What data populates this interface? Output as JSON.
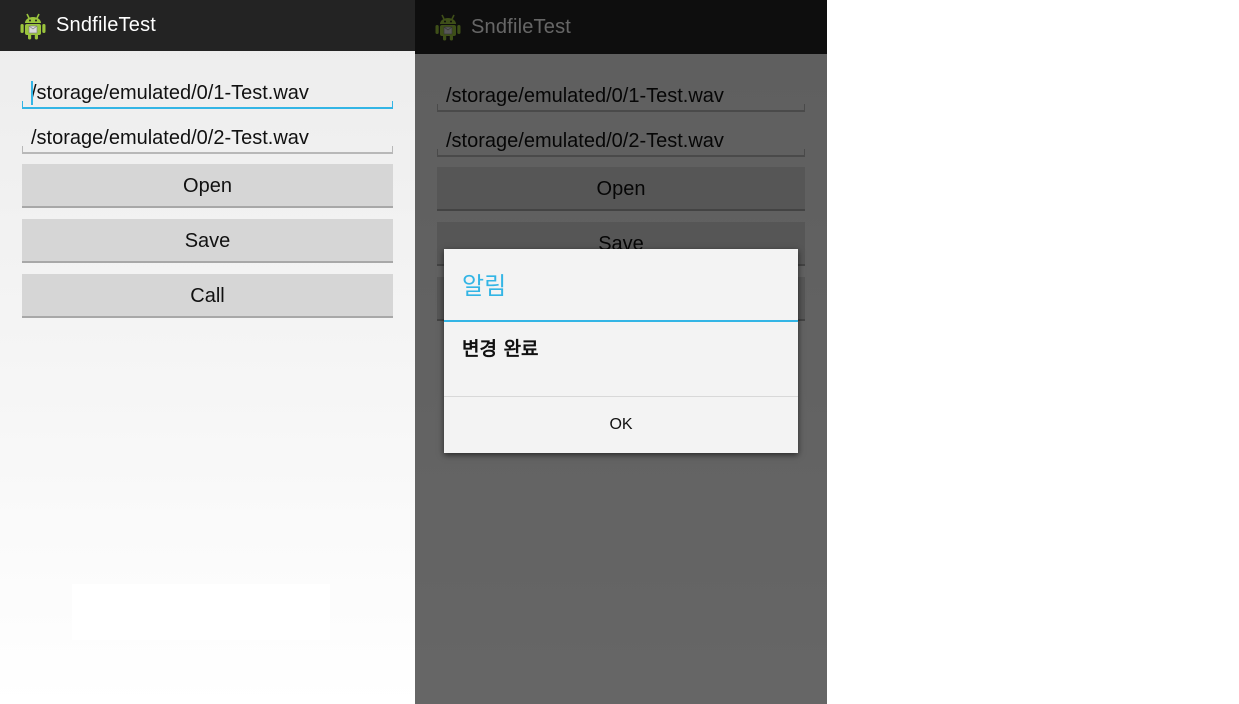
{
  "app": {
    "title": "SndfileTest",
    "icon": "android-robot-icon"
  },
  "form": {
    "path1": "/storage/emulated/0/1-Test.wav",
    "path2": "/storage/emulated/0/2-Test.wav",
    "open_label": "Open",
    "save_label": "Save",
    "call_label": "Call"
  },
  "dialog": {
    "title": "알림",
    "message": "변경 완료",
    "ok_label": "OK"
  },
  "colors": {
    "accent": "#33b5e5",
    "actionbar": "#232323",
    "button": "#d6d6d6",
    "android_green": "#9bc53d"
  }
}
